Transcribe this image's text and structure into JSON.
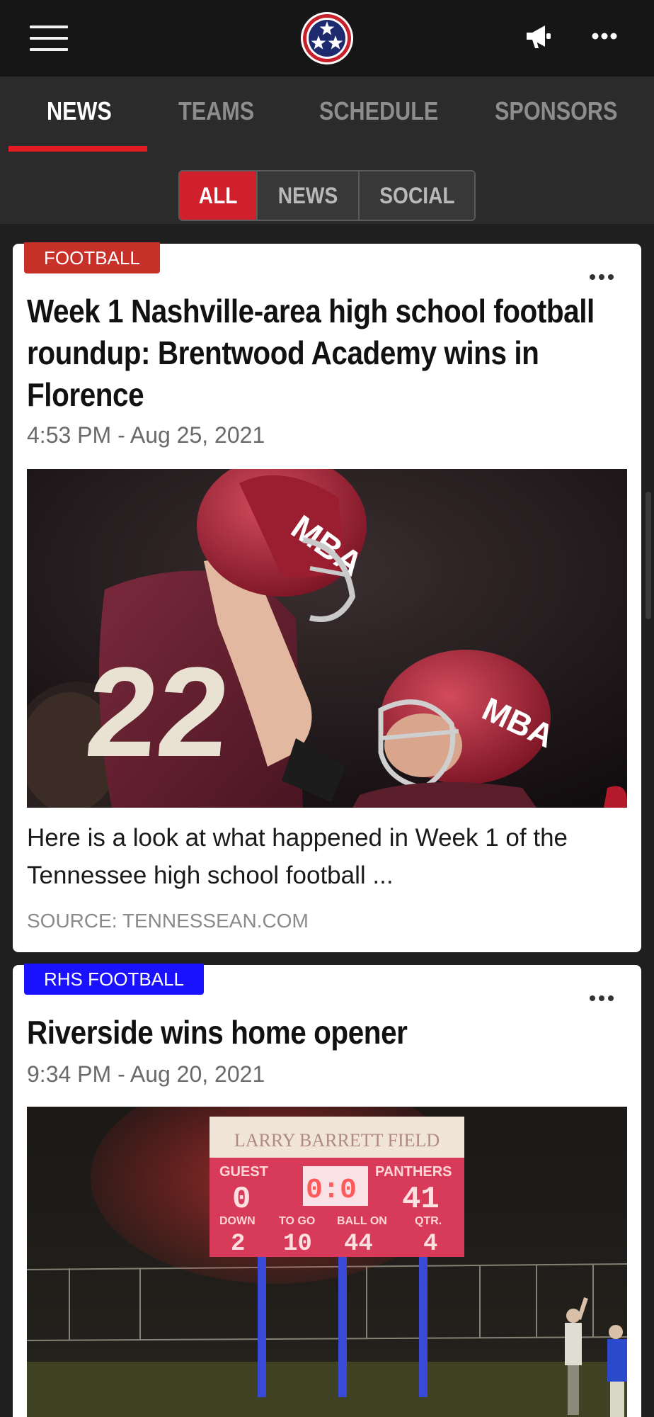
{
  "app": {
    "icons": {
      "menu": "hamburger-icon",
      "logo": "tennessee-tristar-logo",
      "announcements": "megaphone-icon",
      "more": "more-dots-icon"
    },
    "colors": {
      "accent": "#e31b23",
      "top_bar": "#161616",
      "tab_bar": "#2b2b2b"
    }
  },
  "tabs": [
    {
      "label": "NEWS",
      "active": true
    },
    {
      "label": "TEAMS",
      "active": false
    },
    {
      "label": "SCHEDULE",
      "active": false
    },
    {
      "label": "SPONSORS",
      "active": false
    }
  ],
  "filters": [
    {
      "label": "ALL",
      "active": true
    },
    {
      "label": "NEWS",
      "active": false
    },
    {
      "label": "SOCIAL",
      "active": false
    }
  ],
  "articles": [
    {
      "tag": "FOOTBALL",
      "tag_color": "#c8302a",
      "headline": "Week 1 Nashville-area high school football roundup: Brentwood Academy wins in Florence",
      "timestamp": "4:53 PM - Aug 25, 2021",
      "image": "football-players-celebrating-photo",
      "summary": "Here is a look at what happened in Week 1 of the Tennessee high school football ...",
      "source": "SOURCE: TENNESSEAN.COM"
    },
    {
      "tag": "RHS FOOTBALL",
      "tag_color": "#1a12ff",
      "headline": "Riverside wins home opener",
      "timestamp": "9:34 PM - Aug 20, 2021",
      "image": "scoreboard-night-photo",
      "scoreboard": {
        "field_name": "LARRY BARRETT FIELD",
        "guest_label": "GUEST",
        "home_label": "PANTHERS",
        "guest_score": "0",
        "clock": "0:0",
        "home_score": "41",
        "down_label": "DOWN",
        "to_go_label": "TO GO",
        "ball_on_label": "BALL ON",
        "qtr_label": "QTR.",
        "down": "2",
        "to_go": "10",
        "ball_on": "44",
        "qtr": "4"
      }
    }
  ]
}
